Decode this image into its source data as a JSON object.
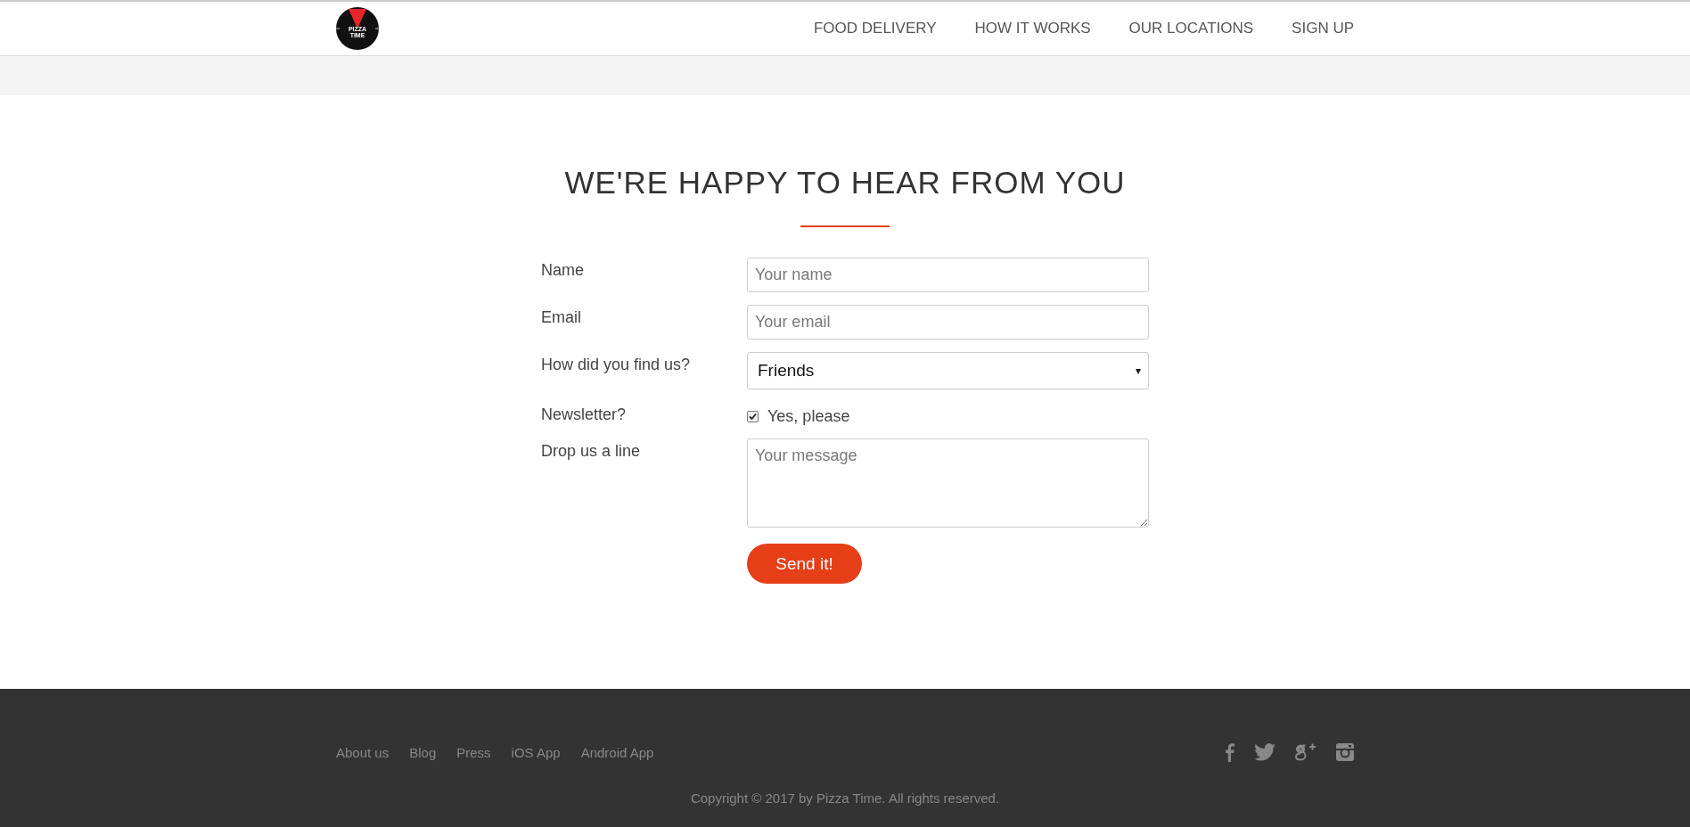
{
  "header": {
    "logo_text": [
      "PIZZA",
      "TIME"
    ],
    "nav": [
      {
        "label": "FOOD DELIVERY"
      },
      {
        "label": "HOW IT WORKS"
      },
      {
        "label": "OUR LOCATIONS"
      },
      {
        "label": "SIGN UP"
      }
    ]
  },
  "contact": {
    "title": "WE'RE HAPPY TO HEAR FROM YOU",
    "fields": [
      {
        "kind": "text",
        "label": "Name",
        "placeholder": "Your name"
      },
      {
        "kind": "text",
        "label": "Email",
        "placeholder": "Your email"
      },
      {
        "kind": "select",
        "label": "How did you find us?",
        "value": "Friends",
        "caret": "▾"
      },
      {
        "kind": "checkbox",
        "label": "Newsletter?",
        "option": "Yes, please",
        "checked": true
      },
      {
        "kind": "textarea",
        "label": "Drop us a line",
        "placeholder": "Your message"
      }
    ],
    "submit": "Send it!"
  },
  "footer": {
    "links": [
      "About us",
      "Blog",
      "Press",
      "iOS App",
      "Android App"
    ],
    "social": [
      {
        "kind": "facebook"
      },
      {
        "kind": "twitter"
      },
      {
        "kind": "google-plus"
      },
      {
        "kind": "instagram"
      }
    ],
    "copyright": "Copyright © 2017 by Pizza Time. All rights reserved."
  }
}
